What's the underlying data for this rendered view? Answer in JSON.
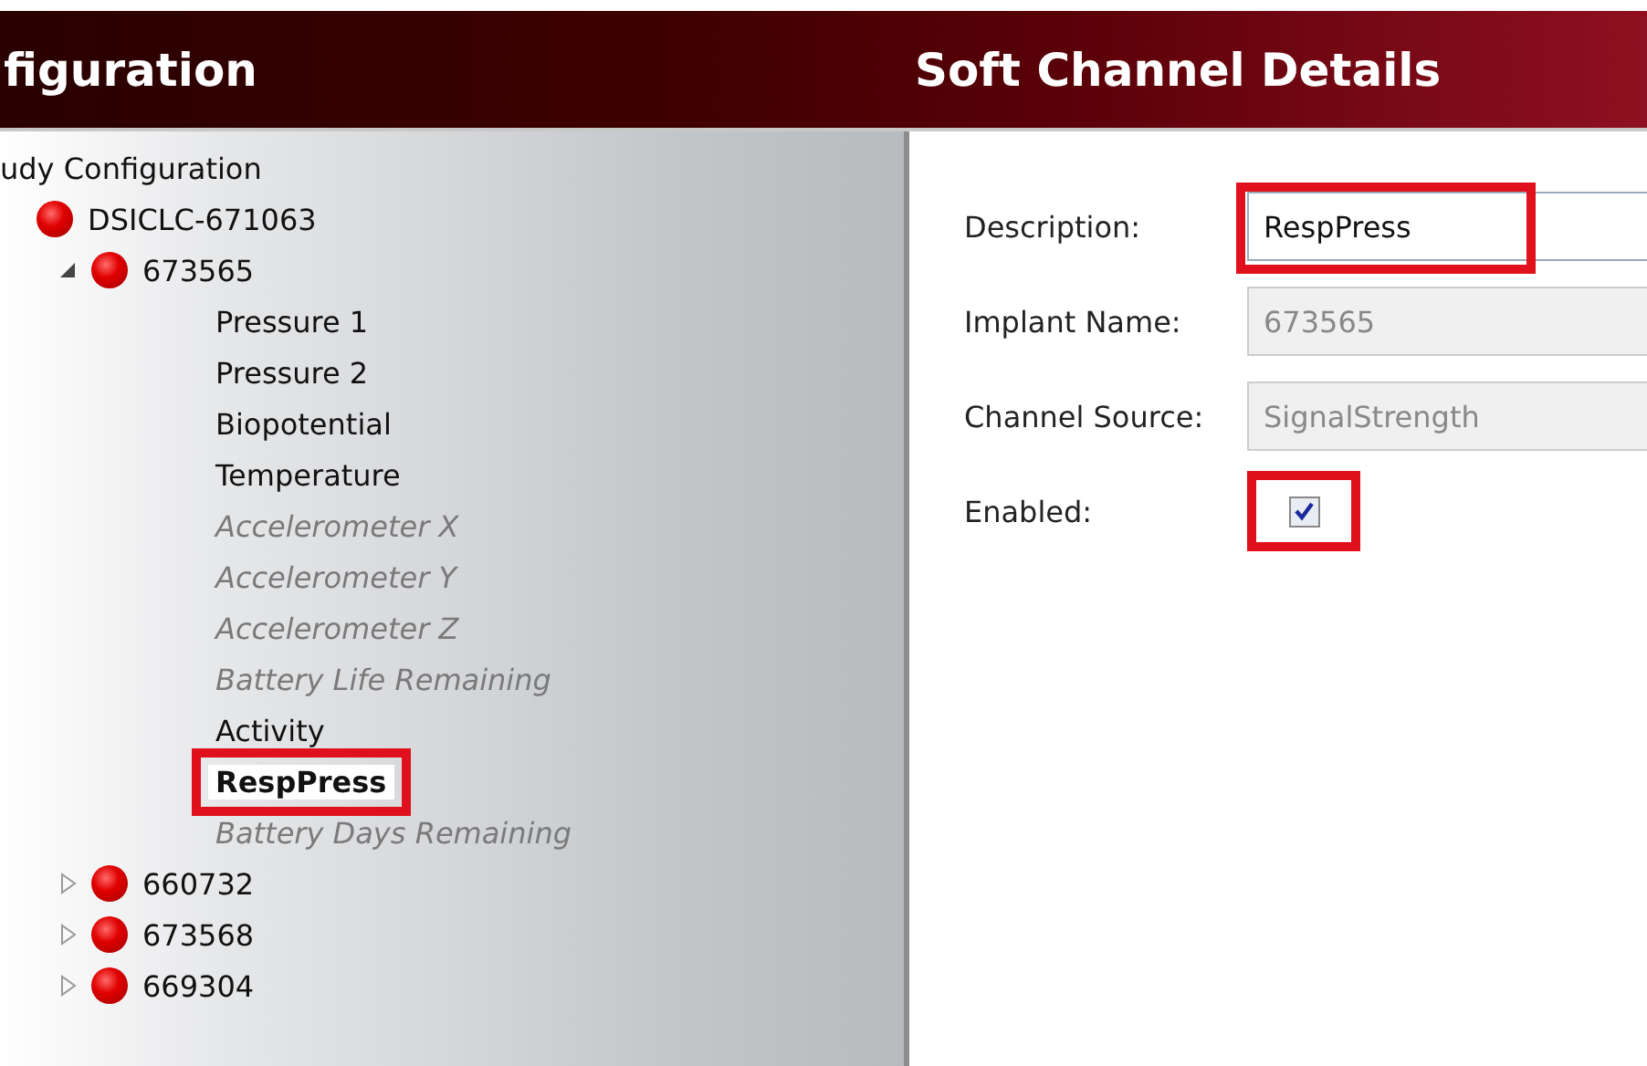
{
  "panels": [
    {
      "title": "figuration"
    },
    {
      "title": "Soft Channel Details"
    }
  ],
  "tree": {
    "label": "udy Configuration",
    "children": [
      {
        "label": "DSICLC-671063",
        "kind": "device",
        "children": [
          {
            "label": "673565",
            "kind": "device",
            "expanded": true,
            "children": [
              {
                "label": "Pressure 1",
                "kind": "channel",
                "disabled": false,
                "highlighted": false
              },
              {
                "label": "Pressure 2",
                "kind": "channel",
                "disabled": false,
                "highlighted": false
              },
              {
                "label": "Biopotential",
                "kind": "channel",
                "disabled": false,
                "highlighted": false
              },
              {
                "label": "Temperature",
                "kind": "channel",
                "disabled": false,
                "highlighted": false
              },
              {
                "label": "Accelerometer X",
                "kind": "channel",
                "disabled": true,
                "highlighted": false
              },
              {
                "label": "Accelerometer Y",
                "kind": "channel",
                "disabled": true,
                "highlighted": false
              },
              {
                "label": "Accelerometer Z",
                "kind": "channel",
                "disabled": true,
                "highlighted": false
              },
              {
                "label": "Battery Life Remaining",
                "kind": "channel",
                "disabled": true,
                "highlighted": false
              },
              {
                "label": "Activity",
                "kind": "channel",
                "disabled": false,
                "highlighted": false
              },
              {
                "label": "RespPress",
                "kind": "channel",
                "disabled": false,
                "highlighted": true
              },
              {
                "label": "Battery Days Remaining",
                "kind": "channel",
                "disabled": true,
                "highlighted": false
              }
            ]
          },
          {
            "label": "660732",
            "kind": "device",
            "expanded": false
          },
          {
            "label": "673568",
            "kind": "device",
            "expanded": false
          },
          {
            "label": "669304",
            "kind": "device",
            "expanded": false
          }
        ]
      }
    ]
  },
  "details": [
    {
      "label": "Description:",
      "kind": "text",
      "value": "RespPress",
      "disabled": false,
      "highlighted": true
    },
    {
      "label": "Implant Name:",
      "kind": "text",
      "value": "673565",
      "disabled": true,
      "highlighted": false
    },
    {
      "label": "Channel Source:",
      "kind": "text",
      "value": "SignalStrength",
      "disabled": true,
      "highlighted": false
    },
    {
      "label": "Enabled:",
      "kind": "checkbox",
      "checked": true,
      "highlighted": true
    }
  ]
}
